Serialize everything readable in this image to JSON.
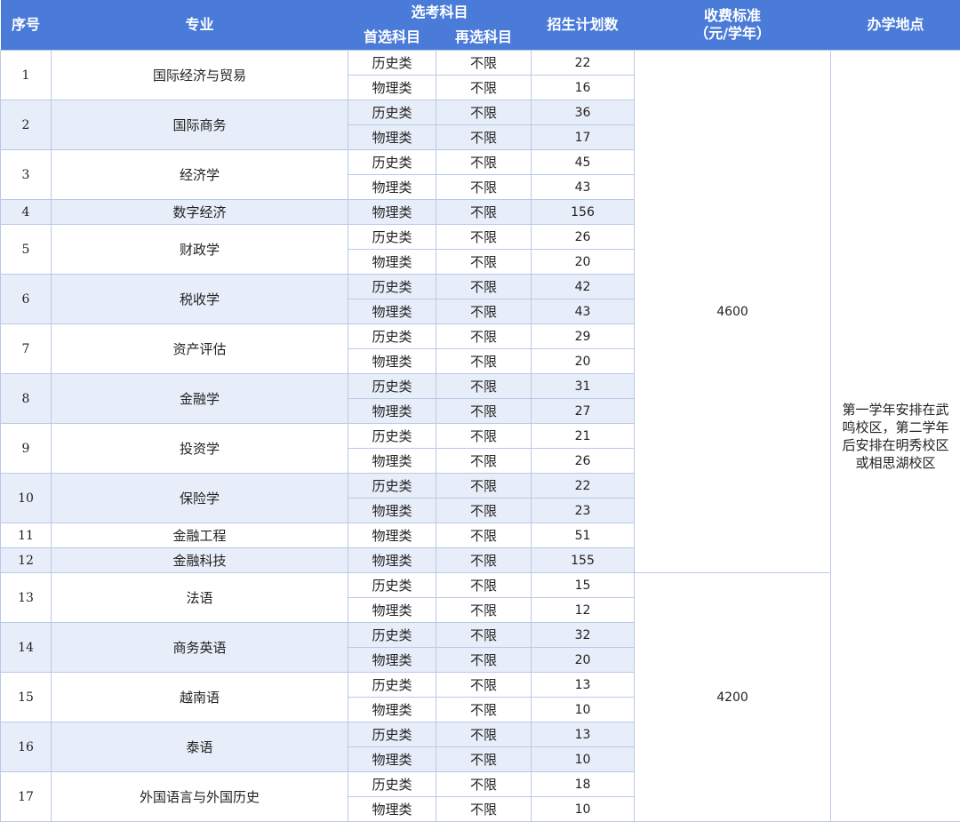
{
  "header": {
    "seq": "序号",
    "major": "专业",
    "subjects": "选考科目",
    "first_subject": "首选科目",
    "second_subject": "再选科目",
    "plan": "招生计划数",
    "fee_line1": "收费标准",
    "fee_line2": "（元/学年）",
    "location": "办学地点"
  },
  "location_text": "第一学年安排在武鸣校区，第二学年后安排在明秀校区或相思湖校区",
  "fee_groups": [
    {
      "fee": "4600",
      "from_major": 1,
      "to_major": 12
    },
    {
      "fee": "4200",
      "from_major": 13,
      "to_major": 17
    }
  ],
  "majors": [
    {
      "seq": "1",
      "name": "国际经济与贸易",
      "rows": [
        {
          "first": "历史类",
          "second": "不限",
          "plan": "22"
        },
        {
          "first": "物理类",
          "second": "不限",
          "plan": "16"
        }
      ]
    },
    {
      "seq": "2",
      "name": "国际商务",
      "rows": [
        {
          "first": "历史类",
          "second": "不限",
          "plan": "36"
        },
        {
          "first": "物理类",
          "second": "不限",
          "plan": "17"
        }
      ]
    },
    {
      "seq": "3",
      "name": "经济学",
      "rows": [
        {
          "first": "历史类",
          "second": "不限",
          "plan": "45"
        },
        {
          "first": "物理类",
          "second": "不限",
          "plan": "43"
        }
      ]
    },
    {
      "seq": "4",
      "name": "数字经济",
      "rows": [
        {
          "first": "物理类",
          "second": "不限",
          "plan": "156"
        }
      ]
    },
    {
      "seq": "5",
      "name": "财政学",
      "rows": [
        {
          "first": "历史类",
          "second": "不限",
          "plan": "26"
        },
        {
          "first": "物理类",
          "second": "不限",
          "plan": "20"
        }
      ]
    },
    {
      "seq": "6",
      "name": "税收学",
      "rows": [
        {
          "first": "历史类",
          "second": "不限",
          "plan": "42"
        },
        {
          "first": "物理类",
          "second": "不限",
          "plan": "43"
        }
      ]
    },
    {
      "seq": "7",
      "name": "资产评估",
      "rows": [
        {
          "first": "历史类",
          "second": "不限",
          "plan": "29"
        },
        {
          "first": "物理类",
          "second": "不限",
          "plan": "20"
        }
      ]
    },
    {
      "seq": "8",
      "name": "金融学",
      "rows": [
        {
          "first": "历史类",
          "second": "不限",
          "plan": "31"
        },
        {
          "first": "物理类",
          "second": "不限",
          "plan": "27"
        }
      ]
    },
    {
      "seq": "9",
      "name": "投资学",
      "rows": [
        {
          "first": "历史类",
          "second": "不限",
          "plan": "21"
        },
        {
          "first": "物理类",
          "second": "不限",
          "plan": "26"
        }
      ]
    },
    {
      "seq": "10",
      "name": "保险学",
      "rows": [
        {
          "first": "历史类",
          "second": "不限",
          "plan": "22"
        },
        {
          "first": "物理类",
          "second": "不限",
          "plan": "23"
        }
      ]
    },
    {
      "seq": "11",
      "name": "金融工程",
      "rows": [
        {
          "first": "物理类",
          "second": "不限",
          "plan": "51"
        }
      ]
    },
    {
      "seq": "12",
      "name": "金融科技",
      "rows": [
        {
          "first": "物理类",
          "second": "不限",
          "plan": "155"
        }
      ]
    },
    {
      "seq": "13",
      "name": "法语",
      "rows": [
        {
          "first": "历史类",
          "second": "不限",
          "plan": "15"
        },
        {
          "first": "物理类",
          "second": "不限",
          "plan": "12"
        }
      ]
    },
    {
      "seq": "14",
      "name": "商务英语",
      "rows": [
        {
          "first": "历史类",
          "second": "不限",
          "plan": "32"
        },
        {
          "first": "物理类",
          "second": "不限",
          "plan": "20"
        }
      ]
    },
    {
      "seq": "15",
      "name": "越南语",
      "rows": [
        {
          "first": "历史类",
          "second": "不限",
          "plan": "13"
        },
        {
          "first": "物理类",
          "second": "不限",
          "plan": "10"
        }
      ]
    },
    {
      "seq": "16",
      "name": "泰语",
      "rows": [
        {
          "first": "历史类",
          "second": "不限",
          "plan": "13"
        },
        {
          "first": "物理类",
          "second": "不限",
          "plan": "10"
        }
      ]
    },
    {
      "seq": "17",
      "name": "外国语言与外国历史",
      "rows": [
        {
          "first": "历史类",
          "second": "不限",
          "plan": "18"
        },
        {
          "first": "物理类",
          "second": "不限",
          "plan": "10"
        }
      ]
    }
  ],
  "colors": {
    "header_bg": "#4a7bd8",
    "band_bg": "#e8eef9",
    "border": "#b9c9e6"
  }
}
